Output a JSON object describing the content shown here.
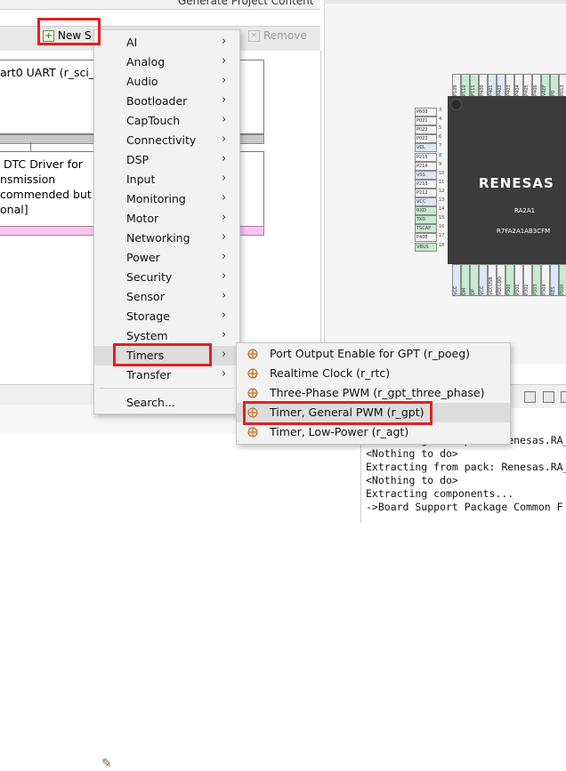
{
  "editor": {
    "generate_link": "Generate Project Content",
    "new_stack_label": "New S",
    "remove_label": "Remove",
    "uart_block_title": "art0 UART (r_sci_ua",
    "dtc_block_lines": [
      "DTC Driver for",
      "nsmission",
      "commended but",
      "onal]"
    ]
  },
  "chip": {
    "logo": "RENESAS",
    "name": "RA2A1",
    "part": "R7FA2A1AB3CFM",
    "top_pins": [
      "P109",
      "P110",
      "P111",
      "P400",
      "P401",
      "P402",
      "P403",
      "P404",
      "P405",
      "P406",
      "VREF",
      "P0",
      "P013",
      "P014",
      "P015"
    ],
    "left_pins": [
      {
        "label": "P603",
        "num": "3"
      },
      {
        "label": "P021",
        "num": "4"
      },
      {
        "label": "P022",
        "num": "5"
      },
      {
        "label": "P023",
        "num": "6"
      },
      {
        "label": "VCL",
        "num": "7"
      },
      {
        "label": "P215",
        "num": "8"
      },
      {
        "label": "P214",
        "num": "9"
      },
      {
        "label": "VSS",
        "num": "10"
      },
      {
        "label": "P213",
        "num": "11"
      },
      {
        "label": "P212",
        "num": "12"
      },
      {
        "label": "VCC",
        "num": "13"
      },
      {
        "label": "RXD",
        "num": "14"
      },
      {
        "label": "TXD",
        "num": "15"
      },
      {
        "label": "TSCAP",
        "num": "16"
      },
      {
        "label": "P408",
        "num": "17"
      },
      {
        "label": "VBUS",
        "num": "18"
      }
    ],
    "bottom_pins": [
      "VCC",
      "DM",
      "DP",
      "VCC",
      "VCCUSB",
      "VCCLDO",
      "P300",
      "P301",
      "P302",
      "P303",
      "P304",
      "RES",
      "P500",
      "P501",
      "P504"
    ]
  },
  "main_menu": {
    "items": [
      {
        "label": "AI",
        "submenu": true
      },
      {
        "label": "Analog",
        "submenu": true
      },
      {
        "label": "Audio",
        "submenu": true
      },
      {
        "label": "Bootloader",
        "submenu": true
      },
      {
        "label": "CapTouch",
        "submenu": true
      },
      {
        "label": "Connectivity",
        "submenu": true
      },
      {
        "label": "DSP",
        "submenu": true
      },
      {
        "label": "Input",
        "submenu": true
      },
      {
        "label": "Monitoring",
        "submenu": true
      },
      {
        "label": "Motor",
        "submenu": true
      },
      {
        "label": "Networking",
        "submenu": true
      },
      {
        "label": "Power",
        "submenu": true
      },
      {
        "label": "Security",
        "submenu": true
      },
      {
        "label": "Sensor",
        "submenu": true
      },
      {
        "label": "Storage",
        "submenu": true
      },
      {
        "label": "System",
        "submenu": true
      },
      {
        "label": "Timers",
        "submenu": true
      },
      {
        "label": "Transfer",
        "submenu": true
      }
    ],
    "search_label": "Search...",
    "arrow": "›"
  },
  "timers_submenu": {
    "items": [
      {
        "label": "Port Output Enable for GPT (r_poeg)"
      },
      {
        "label": "Realtime Clock (r_rtc)"
      },
      {
        "label": "Three-Phase PWM (r_gpt_three_phase)"
      },
      {
        "label": "Timer, General PWM (r_gpt)"
      },
      {
        "label": "Timer, Low-Power (r_agt)"
      }
    ]
  },
  "console": {
    "lines": [
      "Extracting from pack: Renesas.RA_",
      "<Nothing to do>",
      "Extracting from pack: Renesas.RA_",
      "<Nothing to do>",
      "Extracting components...",
      "->Board Support Package Common F"
    ]
  },
  "colors": {
    "highlight": "#e32020",
    "menu_bg": "#f2f2f2",
    "chip_body": "#3b3b3b",
    "pin_green": "#c7ead0"
  }
}
